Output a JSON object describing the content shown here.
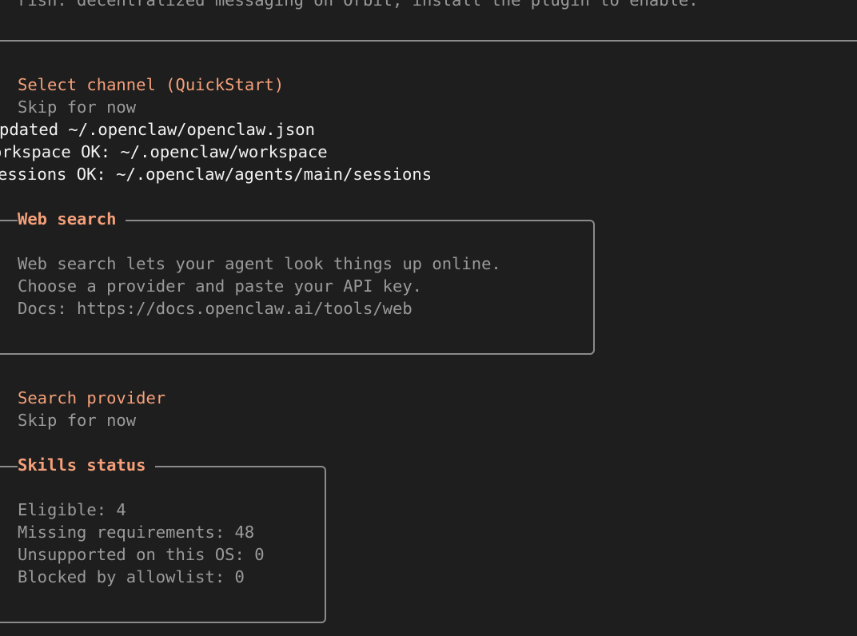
{
  "terminal": {
    "top_cut_line": "rish: decentralized messaging on Orbit, install the plugin to enable.",
    "channel_prompt": "Select channel (QuickStart)",
    "channel_choice": "Skip for now",
    "log_updated": "pdated ~/.openclaw/openclaw.json",
    "log_workspace": "orkspace OK: ~/.openclaw/workspace",
    "log_sessions": "essions OK: ~/.openclaw/agents/main/sessions",
    "web_search": {
      "title": "Web search",
      "lines": [
        "Web search lets your agent look things up online.",
        "Choose a provider and paste your API key.",
        "Docs: https://docs.openclaw.ai/tools/web"
      ]
    },
    "search_provider": {
      "prompt": "Search provider",
      "choice": "Skip for now"
    },
    "skills_status": {
      "title": "Skills status",
      "lines": [
        "Eligible: 4",
        "Missing requirements: 48",
        "Unsupported on this OS: 0",
        "Blocked by allowlist: 0"
      ]
    }
  },
  "colors": {
    "background": "#1e1e1e",
    "accent": "#f5a07a",
    "muted_text": "#9a9a9a",
    "bright_text": "#f2f2f2",
    "border": "#8b8b8b"
  }
}
